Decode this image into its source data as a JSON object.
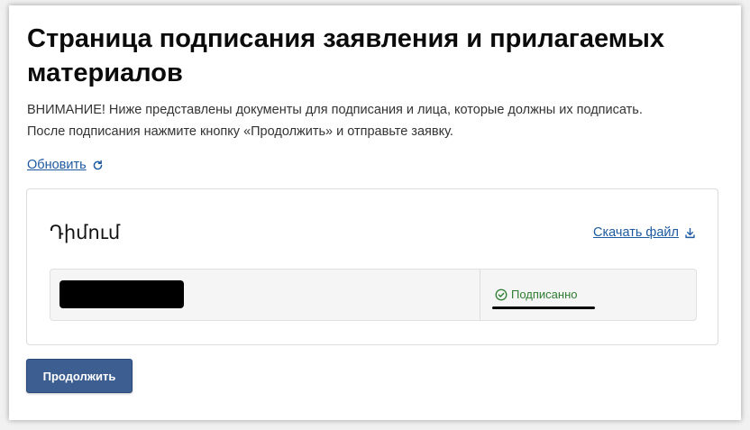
{
  "page": {
    "title": "Страница подписания заявления и прилагаемых материалов",
    "notice_line1": "ВНИМАНИЕ! Ниже представлены документы для подписания и лица, которые должны их подписать.",
    "notice_line2": "После подписания нажмите кнопку «Продолжить» и отправьте заявку.",
    "refresh_label": "Обновить",
    "refresh_icon": "refresh-icon"
  },
  "document": {
    "name": "Դիմում",
    "download_label": "Скачать файл",
    "download_icon": "download-icon",
    "signers": [
      {
        "status": "Подписанно",
        "status_icon": "check-circle-icon",
        "status_color": "#2e7d32"
      }
    ]
  },
  "actions": {
    "continue_label": "Продолжить",
    "continue_color": "#3d5e91"
  },
  "colors": {
    "link": "#1e5aa0",
    "text": "#333333"
  }
}
